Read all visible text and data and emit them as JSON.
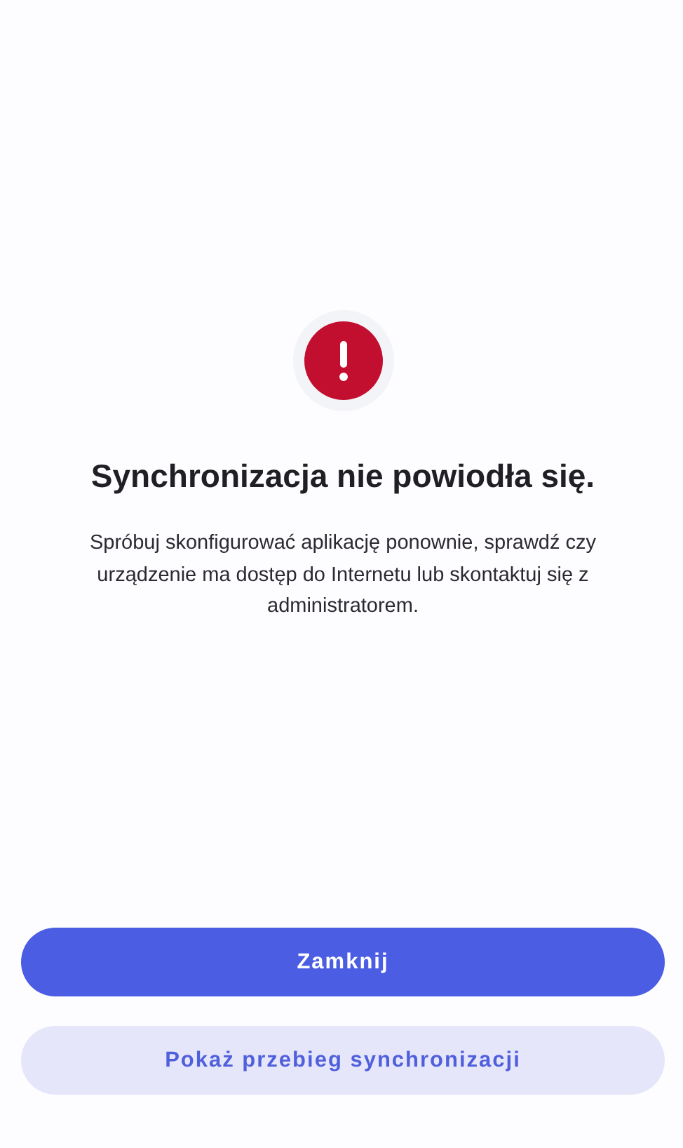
{
  "title": "Synchronizacja nie powiodła się.",
  "message": "Spróbuj skonfigurować aplikację ponownie, sprawdź czy urządzenie ma dostęp do Internetu lub skontaktuj się z administratorem.",
  "buttons": [
    {
      "label": "Zamknij",
      "kind": "primary"
    },
    {
      "label": "Pokaż przebieg synchronizacji",
      "kind": "secondary"
    }
  ]
}
